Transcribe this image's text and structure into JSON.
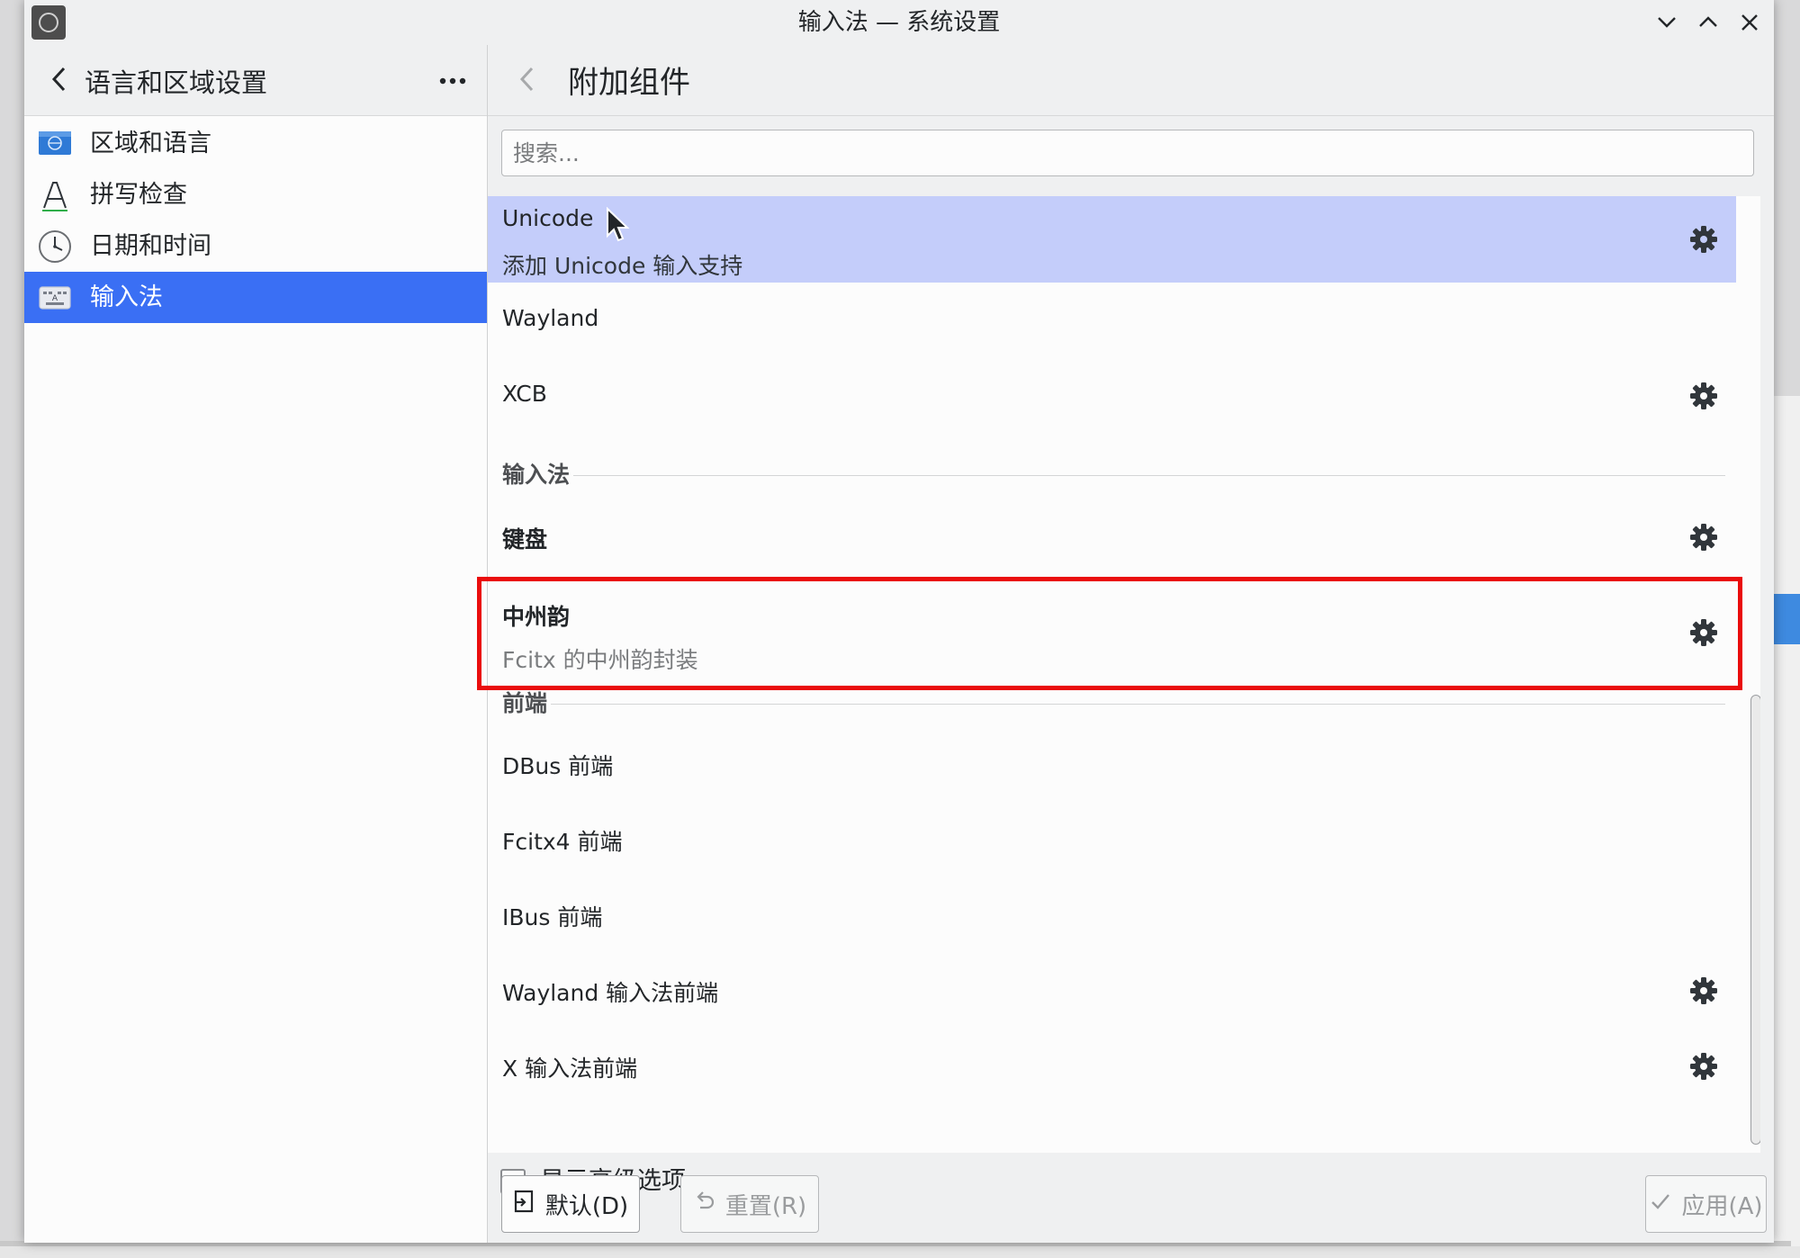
{
  "window": {
    "title": "输入法 — 系统设置"
  },
  "sidebar": {
    "title": "语言和区域设置",
    "items": [
      {
        "label": "区域和语言",
        "icon": "flag-icon"
      },
      {
        "label": "拼写检查",
        "icon": "spellcheck-icon"
      },
      {
        "label": "日期和时间",
        "icon": "clock-icon"
      },
      {
        "label": "输入法",
        "icon": "keyboard-icon",
        "selected": true
      }
    ]
  },
  "main": {
    "title": "附加组件",
    "search_placeholder": "搜索...",
    "addons": {
      "unicode": {
        "title": "Unicode",
        "subtitle": "添加 Unicode 输入支持",
        "configurable": true,
        "selected": true
      },
      "wayland": {
        "title": "Wayland"
      },
      "xcb": {
        "title": "XCB",
        "configurable": true
      },
      "section_input": "输入法",
      "keyboard": {
        "title": "键盘",
        "configurable": true
      },
      "zhongzhouyun": {
        "title": "中州韵",
        "subtitle": "Fcitx 的中州韵封装",
        "configurable": true
      },
      "section_frontend": "前端",
      "dbus": {
        "title": "DBus 前端"
      },
      "fcitx4": {
        "title": "Fcitx4 前端"
      },
      "ibus": {
        "title": "IBus 前端"
      },
      "wayland_im": {
        "title": "Wayland 输入法前端",
        "configurable": true
      },
      "xim": {
        "title": "X 输入法前端",
        "configurable": true
      }
    }
  },
  "footer": {
    "show_advanced_label": "显示高级选项",
    "show_advanced_checked": false,
    "default_label": "默认(D)",
    "reset_label": "重置(R)",
    "apply_label": "应用(A)"
  },
  "colors": {
    "accent": "#3a6ff4",
    "row_selected": "#c4cdfa",
    "highlight_box": "#ea0c0c"
  }
}
